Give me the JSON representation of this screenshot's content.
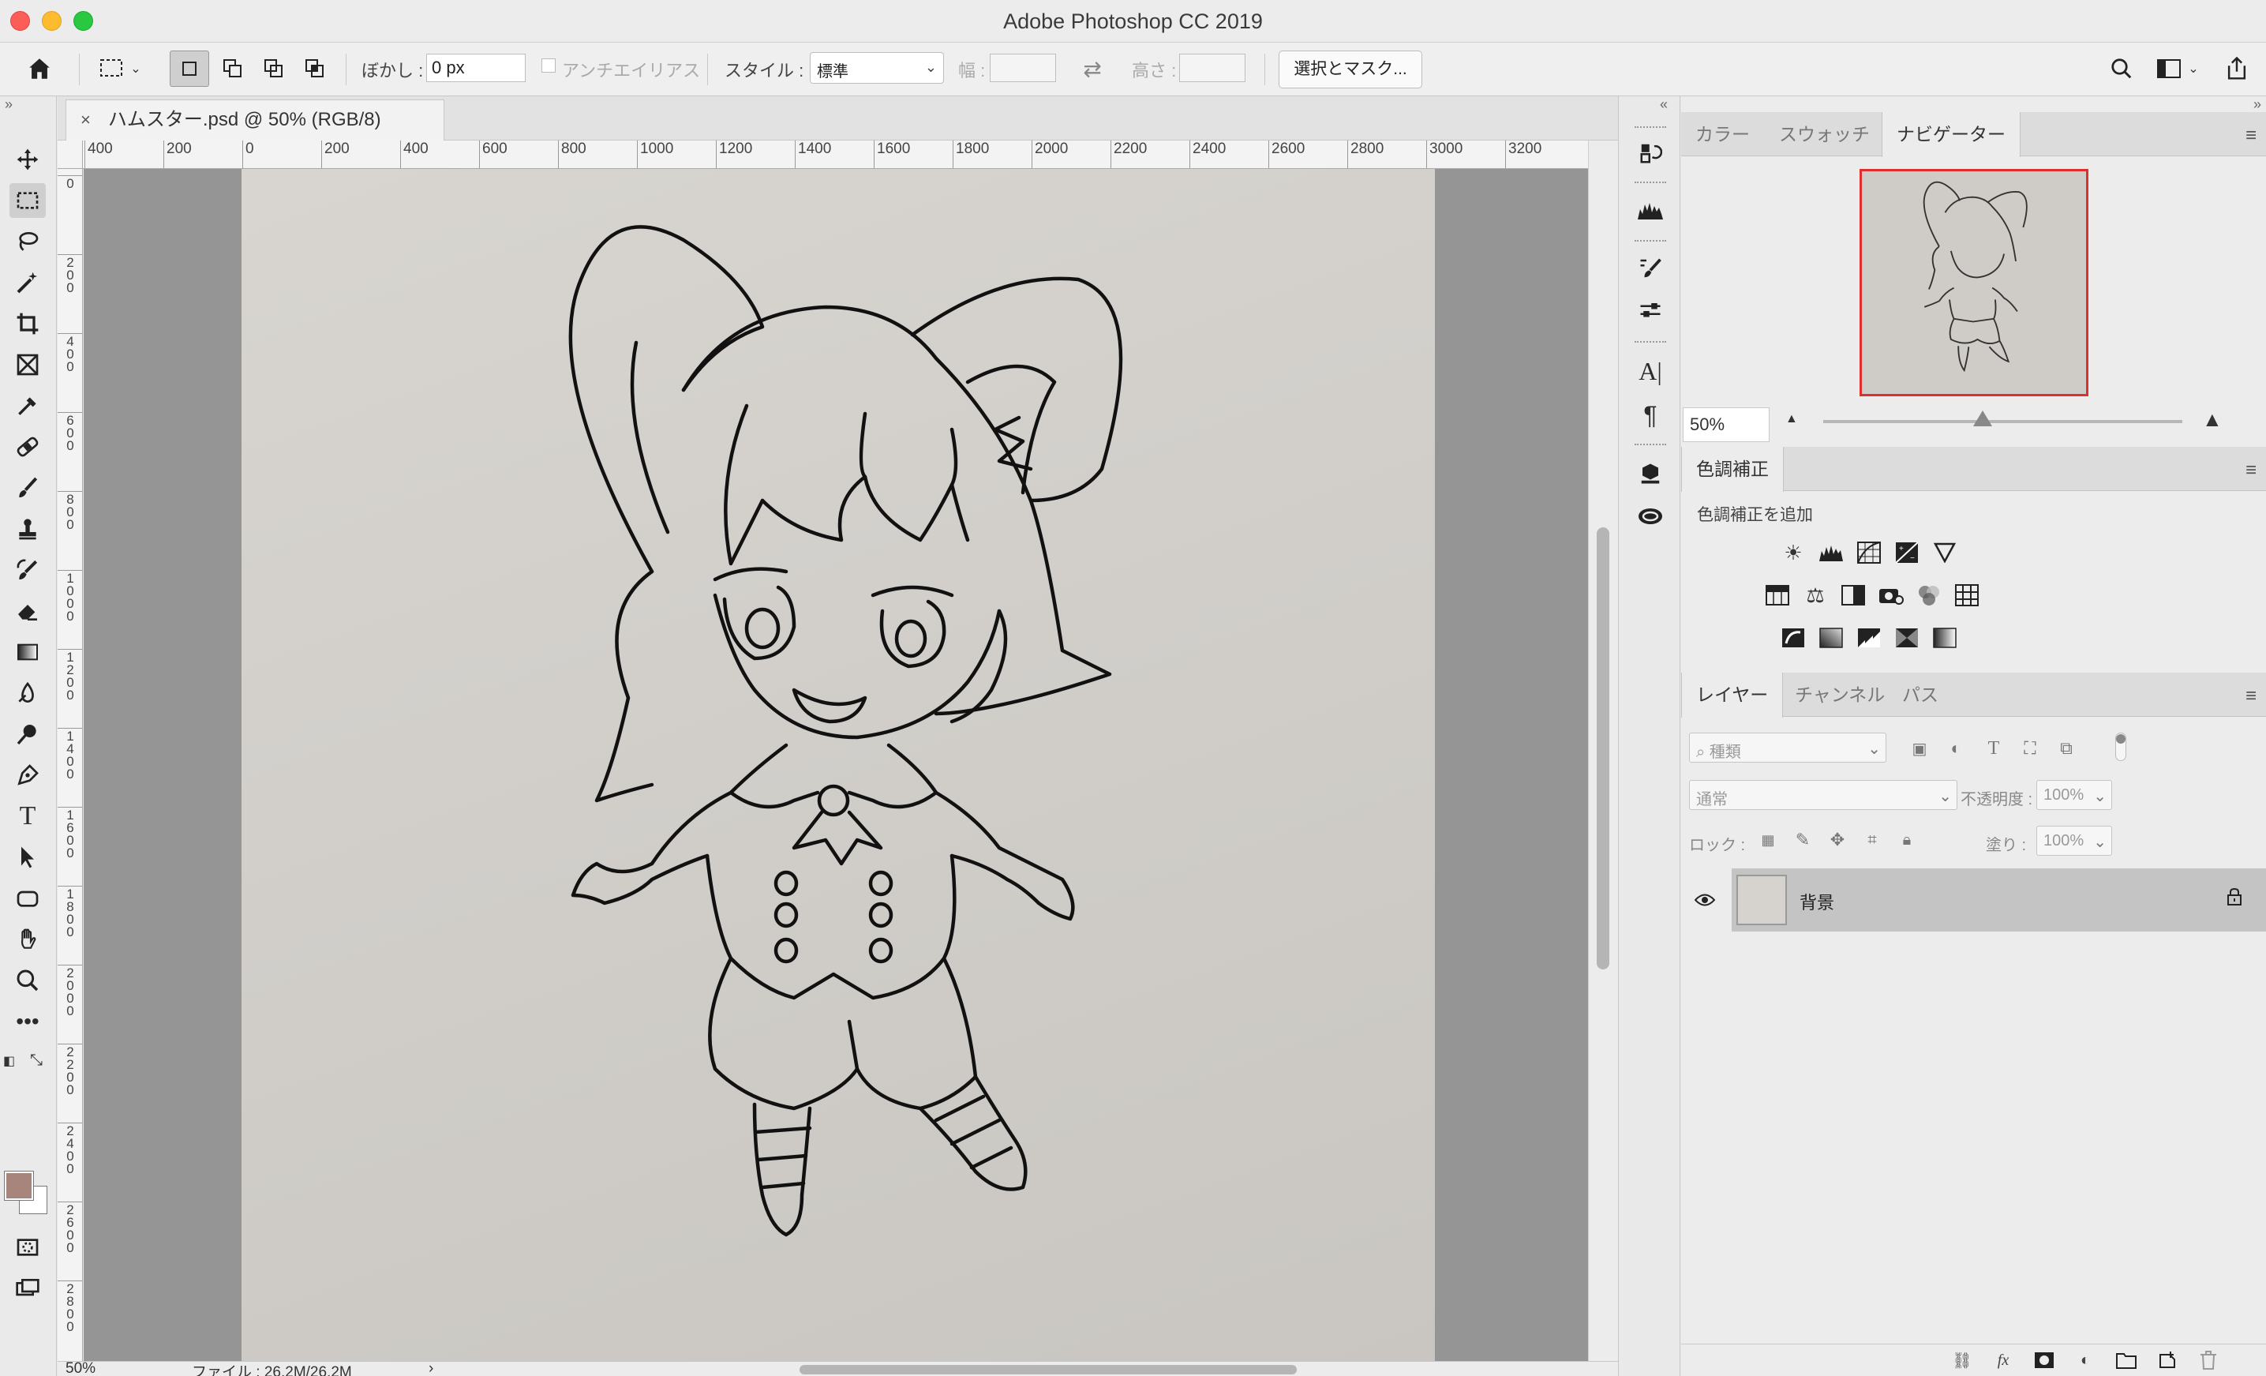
{
  "window": {
    "title": "Adobe Photoshop CC 2019"
  },
  "options": {
    "feather_label": "ぼかし :",
    "feather_value": "0 px",
    "antialias_label": "アンチエイリアス",
    "style_label": "スタイル :",
    "style_value": "標準",
    "width_label": "幅 :",
    "height_label": "高さ :",
    "mask_button": "選択とマスク..."
  },
  "document": {
    "tab_title": "ハムスター.psd @ 50% (RGB/8)",
    "close_glyph": "×"
  },
  "ruler": {
    "top_labels": [
      "400",
      "200",
      "0",
      "200",
      "400",
      "600",
      "800",
      "1000",
      "1200",
      "1400",
      "1600",
      "1800",
      "2000",
      "2200",
      "2400",
      "2600",
      "2800",
      "3000",
      "3200"
    ],
    "left_labels": [
      "0",
      "200",
      "400",
      "600",
      "800",
      "1000",
      "1200",
      "1400",
      "1600",
      "1800",
      "2000",
      "2200",
      "2400",
      "2600",
      "2800"
    ]
  },
  "status": {
    "zoom": "50%",
    "file_info": "ファイル : 26.2M/26.2M",
    "arrow": "›"
  },
  "colors": {
    "foreground": "#a8857c",
    "background": "#ffffff",
    "nav_frame": "#e02d2d"
  },
  "panels": {
    "top_tabs": [
      "カラー",
      "スウォッチ",
      "ナビゲーター"
    ],
    "navigator_zoom": "50%",
    "adjust_tab": "色調補正",
    "adjust_add": "色調補正を追加",
    "layer_tabs": [
      "レイヤー",
      "チャンネル",
      "パス"
    ],
    "kind_placeholder": "種類",
    "blend_mode": "通常",
    "opacity_label": "不透明度 :",
    "opacity_value": "100%",
    "lock_label": "ロック :",
    "fill_label": "塗り :",
    "fill_value": "100%",
    "layer_name": "背景",
    "footer_fx": "fx"
  }
}
